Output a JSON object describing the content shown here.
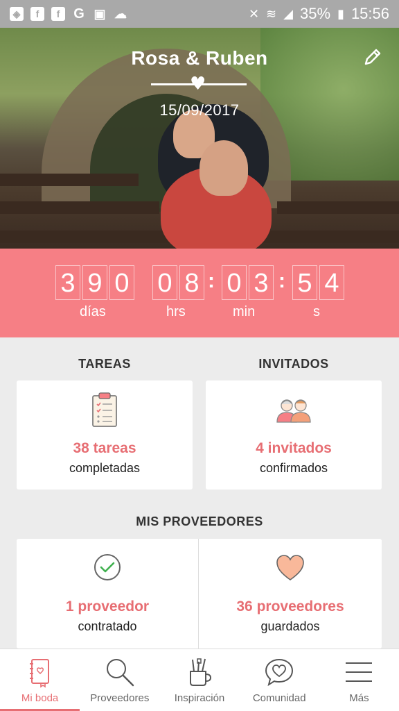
{
  "status_bar": {
    "battery": "35%",
    "time": "15:56",
    "left_icons": [
      "shield-icon",
      "facebook-icon",
      "facebook-icon",
      "google-icon",
      "gallery-icon",
      "cloud-icon"
    ],
    "right_icons": [
      "mute-icon",
      "wifi-icon",
      "signal-icon",
      "battery-charging-icon"
    ]
  },
  "hero": {
    "couple_name": "Rosa & Ruben",
    "date": "15/09/2017"
  },
  "countdown": {
    "days": [
      "3",
      "9",
      "0"
    ],
    "hours": [
      "0",
      "8"
    ],
    "minutes": [
      "0",
      "3"
    ],
    "seconds": [
      "5",
      "4"
    ],
    "labels": {
      "days": "días",
      "hours": "hrs",
      "minutes": "min",
      "seconds": "s"
    }
  },
  "tasks": {
    "title": "TAREAS",
    "count": "38 tareas",
    "sub": "completadas"
  },
  "guests": {
    "title": "INVITADOS",
    "count": "4 invitados",
    "sub": "confirmados"
  },
  "vendors": {
    "title": "MIS PROVEEDORES",
    "hired_count": "1 proveedor",
    "hired_sub": "contratado",
    "saved_count": "36 proveedores",
    "saved_sub": "guardados"
  },
  "nav": {
    "items": [
      {
        "label": "Mi boda",
        "icon": "notebook-icon",
        "active": true
      },
      {
        "label": "Proveedores",
        "icon": "search-icon"
      },
      {
        "label": "Inspiración",
        "icon": "brushes-icon"
      },
      {
        "label": "Comunidad",
        "icon": "chat-heart-icon"
      },
      {
        "label": "Más",
        "icon": "hamburger-icon"
      }
    ]
  },
  "colors": {
    "accent": "#f67f85",
    "accent_text": "#e76e73"
  }
}
